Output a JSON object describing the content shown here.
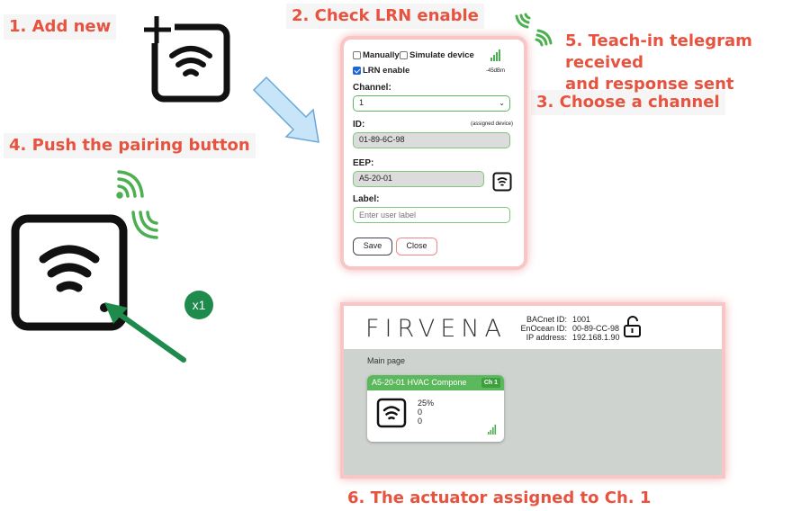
{
  "steps": {
    "s1": "1. Add new",
    "s2": "2. Check LRN enable",
    "s3": "3. Choose a channel",
    "s4": "4. Push the pairing button",
    "s5a": "5. Teach-in telegram received",
    "s5b": "and response sent",
    "s6": "6. The actuator assigned to Ch. 1"
  },
  "badge_x1": "x1",
  "form": {
    "manually_label": "Manually",
    "simulate_label": "Simulate device",
    "lrn_label": "LRN enable",
    "signal": "-45dBm",
    "channel_label": "Channel:",
    "channel_value": "1",
    "id_label": "ID:",
    "id_note": "(assigned device)",
    "id_value": "01-89-6C-98",
    "eep_label": "EEP:",
    "eep_value": "A5-20-01",
    "label_label": "Label:",
    "label_placeholder": "Enter user label",
    "save": "Save",
    "close": "Close"
  },
  "panel": {
    "logo": "FIRVENA",
    "bacnet_key": "BACnet ID:",
    "bacnet_val": "1001",
    "enocean_key": "EnOcean ID:",
    "enocean_val": "00-89-CC-98",
    "ip_key": "IP address:",
    "ip_val": "192.168.1.90",
    "page": "Main page",
    "card_title": "A5-20-01 HVAC Compone",
    "card_ch": "Ch 1",
    "card_v1": "25%",
    "card_v2": "0",
    "card_v3": "0"
  },
  "colors": {
    "accent_red": "#e8533f",
    "green": "#5cb85c",
    "halo": "#f4b4b4"
  },
  "icons": [
    "add-device-icon",
    "wifi-icon",
    "signal-bars-icon",
    "lock-open-icon",
    "radio-waves-icon",
    "arrow-icon"
  ]
}
